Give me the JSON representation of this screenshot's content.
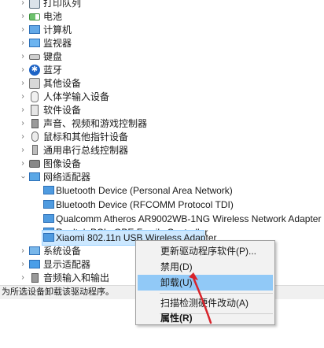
{
  "tree": {
    "categories": [
      {
        "label": "打印队列",
        "icon": "printer-icon"
      },
      {
        "label": "电池",
        "icon": "battery-icon"
      },
      {
        "label": "计算机",
        "icon": "computer-icon"
      },
      {
        "label": "监视器",
        "icon": "monitor-icon"
      },
      {
        "label": "键盘",
        "icon": "keyboard-icon"
      },
      {
        "label": "蓝牙",
        "icon": "bluetooth-icon"
      },
      {
        "label": "其他设备",
        "icon": "other-devices-icon"
      },
      {
        "label": "人体学输入设备",
        "icon": "hid-icon"
      },
      {
        "label": "软件设备",
        "icon": "software-device-icon"
      },
      {
        "label": "声音、视频和游戏控制器",
        "icon": "sound-icon"
      },
      {
        "label": "鼠标和其他指针设备",
        "icon": "mouse-icon"
      },
      {
        "label": "通用串行总线控制器",
        "icon": "usb-icon"
      },
      {
        "label": "图像设备",
        "icon": "imaging-icon"
      },
      {
        "label": "网络适配器",
        "icon": "network-adapter-icon"
      }
    ],
    "network_adapters": [
      "Bluetooth Device (Personal Area Network)",
      "Bluetooth Device (RFCOMM Protocol TDI)",
      "Qualcomm Atheros AR9002WB-1NG Wireless Network Adapter",
      "Realtek PCIe GBE Family Controller",
      "Xiaomi 802.11n USB Wireless Adapter"
    ],
    "after": [
      {
        "label": "系统设备",
        "icon": "system-devices-icon"
      },
      {
        "label": "显示适配器",
        "icon": "display-adapter-icon"
      },
      {
        "label": "音频输入和输出",
        "icon": "audio-io-icon"
      }
    ]
  },
  "context_menu": {
    "update_driver": "更新驱动程序软件(P)...",
    "disable": "禁用(D)",
    "uninstall": "卸载(U)",
    "scan_hardware": "扫描检测硬件改动(A)",
    "properties": "属性(R)"
  },
  "status_bar": {
    "text": "为所选设备卸载该驱动程序。"
  },
  "colors": {
    "selection": "#cce8ff",
    "menu_highlight": "#91c9f7",
    "arrow": "#d8232a"
  }
}
